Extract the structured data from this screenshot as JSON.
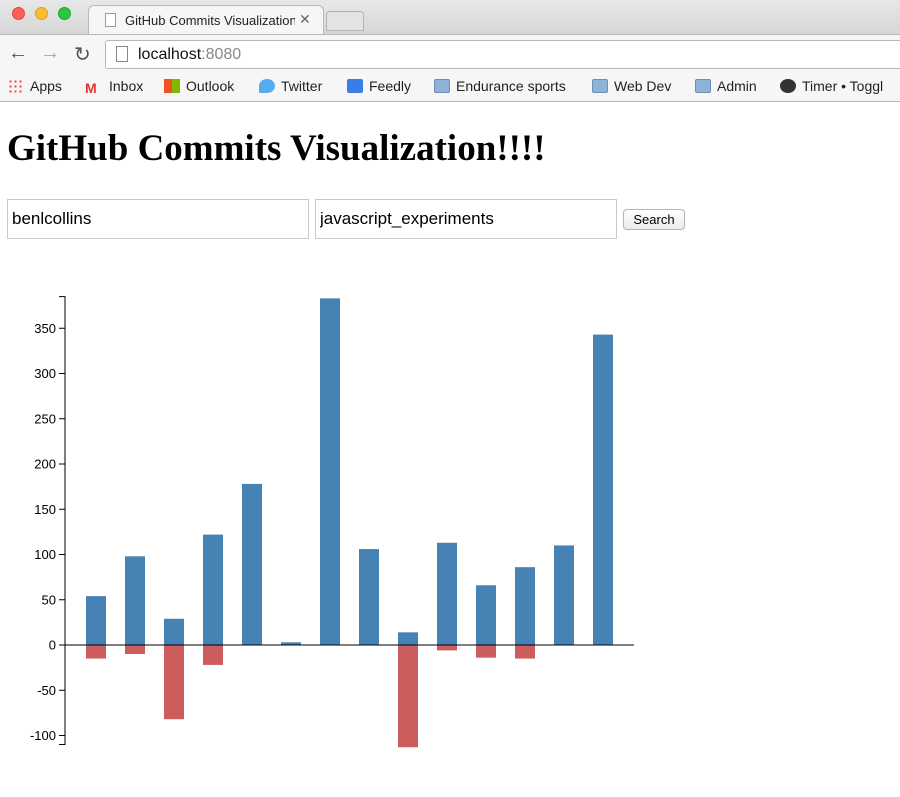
{
  "browser": {
    "tab_title": "GitHub Commits Visualization",
    "url_host": "localhost",
    "url_port": ":8080",
    "bookmarks": [
      "Apps",
      "Inbox",
      "Outlook",
      "Twitter",
      "Feedly",
      "Endurance sports",
      "Web Dev",
      "Admin",
      "Timer • Toggl"
    ]
  },
  "page": {
    "title": "GitHub Commits Visualization!!!!",
    "user_value": "benlcollins",
    "repo_value": "javascript_experiments",
    "search_label": "Search"
  },
  "chart_data": {
    "type": "bar",
    "title": "",
    "xlabel": "",
    "ylabel": "",
    "ylim": [
      -110,
      385
    ],
    "yticks": [
      "350",
      "300",
      "250",
      "200",
      "150",
      "100",
      "50",
      "0",
      "-50",
      "-100"
    ],
    "series": [
      {
        "values": [
          54,
          98,
          29,
          122,
          178,
          3,
          383,
          106,
          14,
          113,
          66,
          86,
          110,
          343
        ],
        "color": "#4682b4"
      },
      {
        "values": [
          -15,
          -10,
          -82,
          -22,
          0,
          0,
          0,
          0,
          -113,
          -6,
          -14,
          -15,
          0,
          0
        ],
        "color": "#cd5c5c"
      }
    ]
  }
}
